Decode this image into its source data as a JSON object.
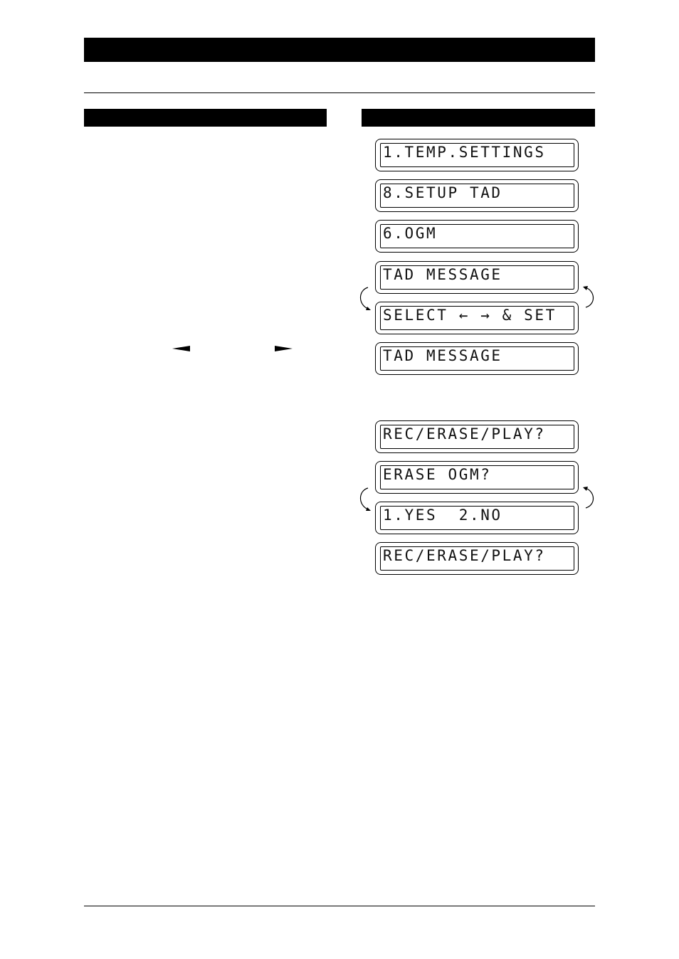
{
  "lcd_sequence_1": [
    {
      "text": "1.TEMP.SETTINGS"
    },
    {
      "text": "8.SETUP TAD"
    },
    {
      "text": "6.OGM"
    },
    {
      "text": "TAD MESSAGE"
    },
    {
      "text": "SELECT ← → & SET"
    },
    {
      "text": "TAD MESSAGE"
    }
  ],
  "lcd_sequence_2": [
    {
      "text": "REC/ERASE/PLAY?"
    },
    {
      "text": "ERASE OGM?"
    },
    {
      "text": "1.YES  2.NO"
    },
    {
      "text": "REC/ERASE/PLAY?"
    }
  ],
  "icons": {
    "left_key": "left-arrow-key-icon",
    "right_key": "right-arrow-key-icon",
    "cycle": "alternating-display-arrows"
  }
}
